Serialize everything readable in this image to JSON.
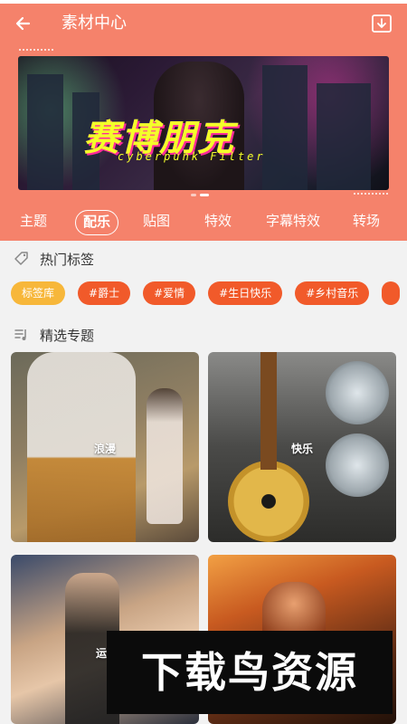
{
  "header": {
    "title": "素材中心",
    "bg_color": "#f5826b",
    "back_icon": "arrow-left-icon",
    "download_icon": "download-icon"
  },
  "banner": {
    "title": "赛博朋克",
    "subtitle": "cyberpunk Filter",
    "pager": {
      "count": 2,
      "active_index": 1
    }
  },
  "tabs": [
    {
      "label": "主题",
      "active": false
    },
    {
      "label": "配乐",
      "active": true
    },
    {
      "label": "贴图",
      "active": false
    },
    {
      "label": "特效",
      "active": false
    },
    {
      "label": "字幕特效",
      "active": false
    },
    {
      "label": "转场",
      "active": false
    }
  ],
  "hot_tags": {
    "heading": "热门标签",
    "icon": "tag-icon",
    "chips": [
      "标签库",
      "#爵士",
      "#爱情",
      "#生日快乐",
      "#乡村音乐"
    ],
    "first_chip_color": "#f7b73a",
    "chip_color": "#f15a2a"
  },
  "featured": {
    "heading": "精选专题",
    "icon": "music-list-icon",
    "cards": [
      {
        "label": "浪漫"
      },
      {
        "label": "快乐"
      },
      {
        "label": "运"
      },
      {
        "label": ""
      }
    ]
  },
  "watermark": {
    "text": "下载鸟资源"
  }
}
